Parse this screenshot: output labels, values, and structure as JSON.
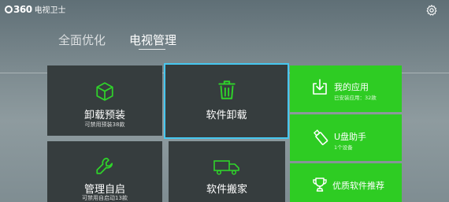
{
  "app": {
    "logo_mark": "360",
    "name": "电视卫士"
  },
  "tabs": [
    {
      "label": "全面优化"
    },
    {
      "label": "电视管理"
    }
  ],
  "tiles": {
    "uninstall_preinstalled": {
      "title": "卸载预装",
      "subtitle": "可禁用预装38款"
    },
    "software_uninstall": {
      "title": "软件卸载"
    },
    "my_apps": {
      "title": "我的应用",
      "subtitle": "已安装应用：32款"
    },
    "usb_helper": {
      "title": "U盘助手",
      "subtitle": "1个设备"
    },
    "startup_manager": {
      "title": "管理自启",
      "subtitle": "可禁用自启动13款"
    },
    "software_move": {
      "title": "软件搬家"
    },
    "recommended": {
      "title": "优质软件推荐"
    }
  },
  "colors": {
    "tile_dark": "#363d3e",
    "tile_green": "#2ecc23",
    "focus": "#46c7ef"
  }
}
